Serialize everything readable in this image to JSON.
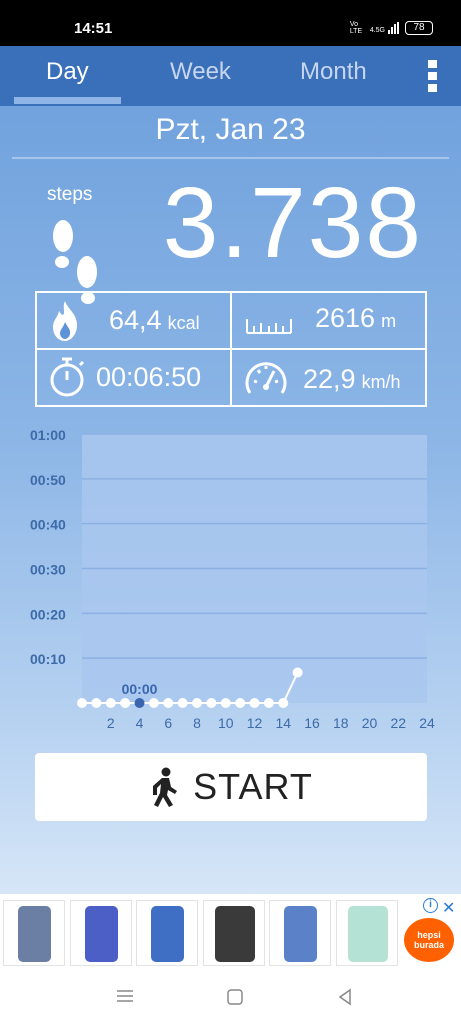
{
  "status_bar": {
    "time": "14:51",
    "network": "Vo LTE",
    "data": "4.5G",
    "battery": "78"
  },
  "tabs": [
    {
      "label": "Day",
      "active": true
    },
    {
      "label": "Week",
      "active": false
    },
    {
      "label": "Month",
      "active": false
    }
  ],
  "date": "Pzt, Jan 23",
  "steps": {
    "label": "steps",
    "value": "3.738"
  },
  "stats": {
    "calories": {
      "value": "64,4",
      "unit": "kcal",
      "icon": "flame-icon"
    },
    "distance": {
      "value": "2616",
      "unit": "m",
      "icon": "ruler-icon"
    },
    "duration": {
      "value": "00:06:50",
      "icon": "stopwatch-icon"
    },
    "speed": {
      "value": "22,9",
      "unit": "km/h",
      "icon": "speedometer-icon"
    }
  },
  "chart_data": {
    "type": "line",
    "y_ticks": [
      "01:00",
      "00:50",
      "00:40",
      "00:30",
      "00:20",
      "00:10"
    ],
    "x_ticks": [
      "2",
      "4",
      "6",
      "8",
      "10",
      "12",
      "14",
      "16",
      "18",
      "20",
      "22",
      "24"
    ],
    "xlim": [
      0,
      24
    ],
    "ylim": [
      0,
      60
    ],
    "y_unit_minutes": true,
    "points": [
      {
        "x": 0,
        "y": 0
      },
      {
        "x": 1,
        "y": 0
      },
      {
        "x": 2,
        "y": 0
      },
      {
        "x": 3,
        "y": 0
      },
      {
        "x": 4,
        "y": 0
      },
      {
        "x": 5,
        "y": 0
      },
      {
        "x": 6,
        "y": 0
      },
      {
        "x": 7,
        "y": 0
      },
      {
        "x": 8,
        "y": 0
      },
      {
        "x": 9,
        "y": 0
      },
      {
        "x": 10,
        "y": 0
      },
      {
        "x": 11,
        "y": 0
      },
      {
        "x": 12,
        "y": 0
      },
      {
        "x": 13,
        "y": 0
      },
      {
        "x": 14,
        "y": 0
      },
      {
        "x": 15,
        "y": 6.8
      }
    ],
    "selected": {
      "x": 4,
      "label": "00:00"
    },
    "colors": {
      "line": "#ffffff",
      "selected": "#3a66b0",
      "plot_bg": "#a9c7ef",
      "grid": "#8cb0e3",
      "tick_text": "#3d6aa8"
    }
  },
  "start_button": {
    "label": "START",
    "icon": "walking-person-icon"
  },
  "ad": {
    "phones": [
      {
        "color": "#6a7fa3"
      },
      {
        "color": "#4b5fc7"
      },
      {
        "color": "#3f6fc4"
      },
      {
        "color": "#3a3a3a"
      },
      {
        "color": "#5b82c9"
      },
      {
        "color": "#b4e3d6"
      }
    ],
    "brand": "hepsi burada"
  },
  "colors": {
    "tabbar": "#3a6fba",
    "accent": "#ffffff"
  }
}
